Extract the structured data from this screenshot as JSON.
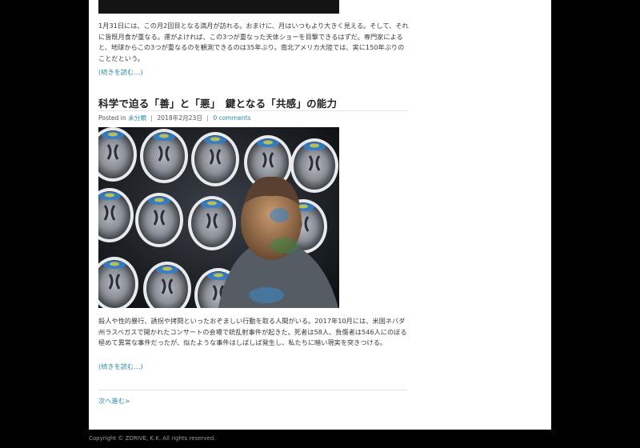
{
  "previous_post": {
    "excerpt": "1月31日には、この月2回目となる満月が訪れる。おまけに、月はいつもより大きく見える。そして、それに皆既月食が重なる。運がよければ、この3つが重なった天体ショーを目撃できるはずだ。専門家によると、地球からこの3つが重なるのを観測できるのは35年ぶり。南北アメリカ大陸では、実に150年ぶりのことだという。",
    "read_more": "(続きを読む…)"
  },
  "post": {
    "title": "科学で迫る「善」と「悪」　鍵となる「共感」の能力",
    "meta": {
      "posted_in_label": "Posted in",
      "category": "未分類",
      "date": "2018年2月23日",
      "comments": "0 comments"
    },
    "image_subject": "man in front of projected brain scan images",
    "excerpt": "殺人や性的暴行、誘拐や拷問といったおぞましい行動を取る人間がいる。2017年10月には、米国ネバダ州ラスベガスで開かれたコンサートの会場で銃乱射事件が起きた。死者は58人、負傷者は546人にのぼる極めて異常な事件だったが、似たような事件はしばしば発生し、私たちに暗い現実を突きつける。",
    "read_more": "(続きを読む…)"
  },
  "pagination": {
    "next": "次へ進む>"
  },
  "footer": {
    "copyright": "Copyright © ZDRIVE, K.K. All rights reserved."
  },
  "colors": {
    "background": "#000000",
    "content": "#ffffff",
    "link": "#2a8aa0",
    "text": "#3a3a3a"
  }
}
